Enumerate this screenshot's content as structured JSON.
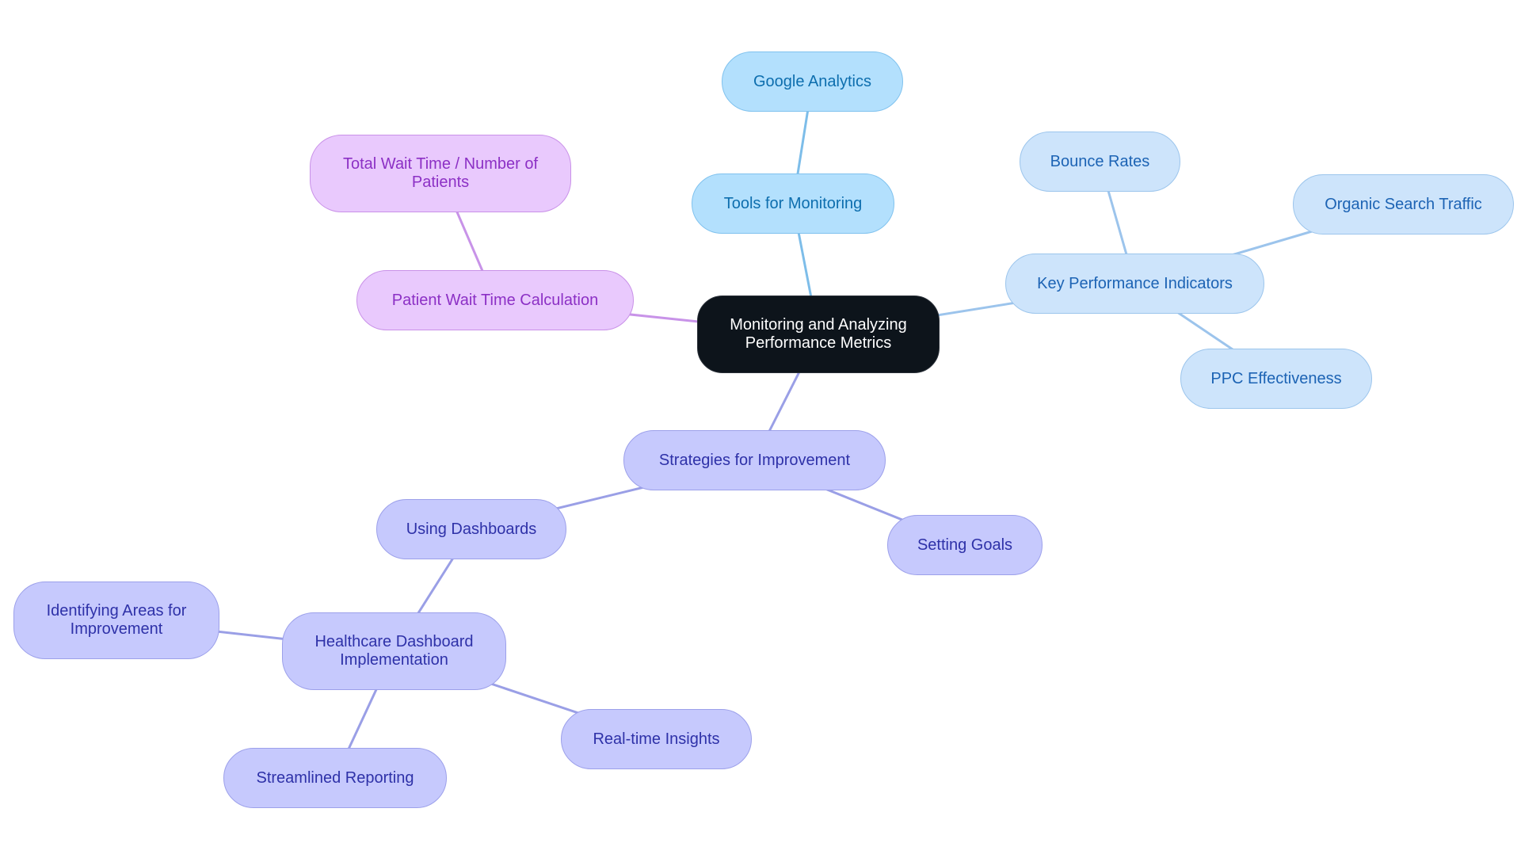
{
  "diagram": {
    "type": "mindmap",
    "root": {
      "id": "root",
      "label": "Monitoring and Analyzing Performance Metrics"
    },
    "palette": {
      "root": {
        "fill": "#0d141b",
        "text": "#ffffff"
      },
      "tools": {
        "fill": "#b3e0fd",
        "stroke": "#80c2ee",
        "text": "#0d6eae",
        "edge": "#7dbde9"
      },
      "kpi": {
        "fill": "#cde4fb",
        "stroke": "#9cc5ec",
        "text": "#1c63b4",
        "edge": "#9cc4ec"
      },
      "wait": {
        "fill": "#e9c9fd",
        "stroke": "#c991e8",
        "text": "#8c30c5",
        "edge": "#c893e8"
      },
      "strat": {
        "fill": "#c6c9fd",
        "stroke": "#9ca0ea",
        "text": "#2e31a8",
        "edge": "#9a9fe6"
      }
    },
    "nodes": {
      "root": "Monitoring and Analyzing Performance Metrics",
      "tools": "Tools for Monitoring",
      "google": "Google Analytics",
      "kpi": "Key Performance Indicators",
      "bounce": "Bounce Rates",
      "organic": "Organic Search Traffic",
      "ppc": "PPC Effectiveness",
      "wait": "Patient Wait Time Calculation",
      "formula": "Total Wait Time / Number of Patients",
      "strat": "Strategies for Improvement",
      "dash": "Using Dashboards",
      "goals": "Setting Goals",
      "health": "Healthcare Dashboard Implementation",
      "identify": "Identifying Areas for Improvement",
      "realtime": "Real-time Insights",
      "stream": "Streamlined Reporting"
    },
    "edges": [
      {
        "from": "root",
        "to": "tools",
        "group": "tools"
      },
      {
        "from": "tools",
        "to": "google",
        "group": "tools"
      },
      {
        "from": "root",
        "to": "kpi",
        "group": "kpi"
      },
      {
        "from": "kpi",
        "to": "bounce",
        "group": "kpi"
      },
      {
        "from": "kpi",
        "to": "organic",
        "group": "kpi"
      },
      {
        "from": "kpi",
        "to": "ppc",
        "group": "kpi"
      },
      {
        "from": "root",
        "to": "wait",
        "group": "wait"
      },
      {
        "from": "wait",
        "to": "formula",
        "group": "wait"
      },
      {
        "from": "root",
        "to": "strat",
        "group": "strat"
      },
      {
        "from": "strat",
        "to": "dash",
        "group": "strat"
      },
      {
        "from": "strat",
        "to": "goals",
        "group": "strat"
      },
      {
        "from": "dash",
        "to": "health",
        "group": "strat"
      },
      {
        "from": "health",
        "to": "identify",
        "group": "strat"
      },
      {
        "from": "health",
        "to": "realtime",
        "group": "strat"
      },
      {
        "from": "health",
        "to": "stream",
        "group": "strat"
      }
    ]
  }
}
